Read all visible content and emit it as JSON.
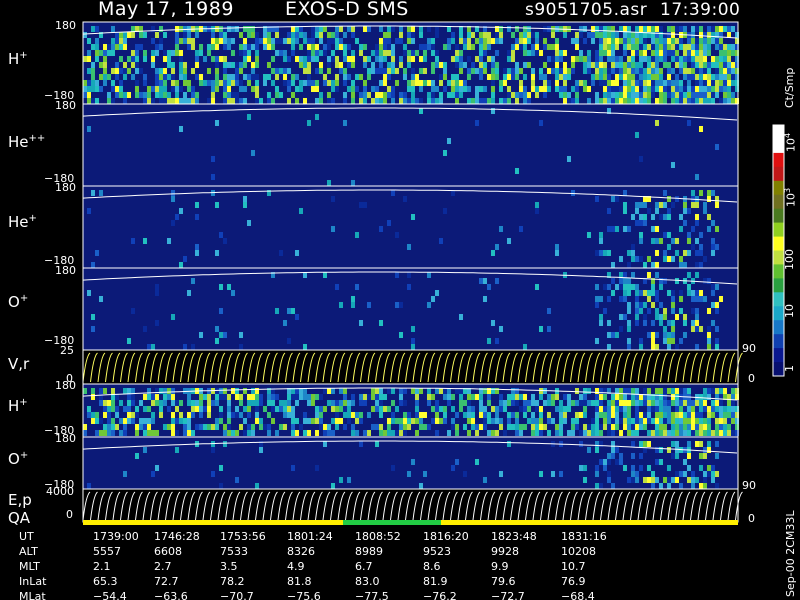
{
  "title": {
    "date": "May 17, 1989",
    "instrument": "EXOS-D SMS",
    "file": "s9051705.asr",
    "time": "17:39:00"
  },
  "chart_data": {
    "type": "heatmap",
    "panels": [
      {
        "id": "h1",
        "label_main": "H",
        "label_sup": "+",
        "ytick_top": "180",
        "ytick_bottom": "−180",
        "kind": "spectrogram",
        "intensity": "high"
      },
      {
        "id": "he2",
        "label_main": "He",
        "label_sup": "++",
        "ytick_top": "180",
        "ytick_bottom": "−180",
        "kind": "spectrogram",
        "intensity": "low"
      },
      {
        "id": "he1",
        "label_main": "He",
        "label_sup": "+",
        "ytick_top": "180",
        "ytick_bottom": "−180",
        "kind": "spectrogram",
        "intensity": "medium"
      },
      {
        "id": "o1",
        "label_main": "O",
        "label_sup": "+",
        "ytick_top": "180",
        "ytick_bottom": "−180",
        "kind": "spectrogram",
        "intensity": "medium"
      },
      {
        "id": "vr",
        "label_main": "V,r",
        "label_sup": "",
        "ytick_top": "25",
        "ytick_bottom": "0",
        "right_tick_top": "90",
        "right_tick_bottom": "0",
        "kind": "line"
      },
      {
        "id": "h2",
        "label_main": "H",
        "label_sup": "+",
        "ytick_top": "180",
        "ytick_bottom": "−180",
        "kind": "spectrogram",
        "intensity": "high"
      },
      {
        "id": "o2",
        "label_main": "O",
        "label_sup": "+",
        "ytick_top": "180",
        "ytick_bottom": "−180",
        "kind": "spectrogram",
        "intensity": "medium"
      },
      {
        "id": "ep",
        "label_main": "E,p",
        "label_sup": "",
        "label2": "QA",
        "ytick_top": "4000",
        "ytick_bottom": "0",
        "right_tick_top": "90",
        "right_tick_bottom": "0",
        "kind": "line"
      }
    ],
    "colorbar": {
      "unit": "Ct/Smp",
      "tick_labels": [
        "1",
        "10",
        "100",
        "10",
        "10"
      ],
      "tick_exponents": [
        "",
        "",
        "",
        "3",
        "4"
      ],
      "scale": "log",
      "range": [
        1,
        10000
      ]
    },
    "columns": [
      "1739:00",
      "1746:28",
      "1753:56",
      "1801:24",
      "1808:52",
      "1816:20",
      "1823:48",
      "1831:16"
    ],
    "rows": [
      {
        "label": "UT",
        "values": [
          "1739:00",
          "1746:28",
          "1753:56",
          "1801:24",
          "1808:52",
          "1816:20",
          "1823:48",
          "1831:16"
        ]
      },
      {
        "label": "ALT",
        "values": [
          "5557",
          "6608",
          "7533",
          "8326",
          "8989",
          "9523",
          "9928",
          "10208"
        ]
      },
      {
        "label": "MLT",
        "values": [
          "2.1",
          "2.7",
          "3.5",
          "4.9",
          "6.7",
          "8.6",
          "9.9",
          "10.7"
        ]
      },
      {
        "label": "InLat",
        "values": [
          "65.3",
          "72.7",
          "78.2",
          "81.8",
          "83.0",
          "81.9",
          "79.6",
          "76.9"
        ]
      },
      {
        "label": "MLat",
        "values": [
          "−54.4",
          "−63.6",
          "−70.7",
          "−75.6",
          "−77.5",
          "−76.2",
          "−72.7",
          "−68.4"
        ]
      }
    ]
  },
  "footer": {
    "version": "Sep-00 2CM33L"
  },
  "colors": {
    "background": "#000000",
    "panel_fill": "#0c1a78",
    "qa_good": "#ffee00",
    "qa_flag": "#22cc44"
  }
}
